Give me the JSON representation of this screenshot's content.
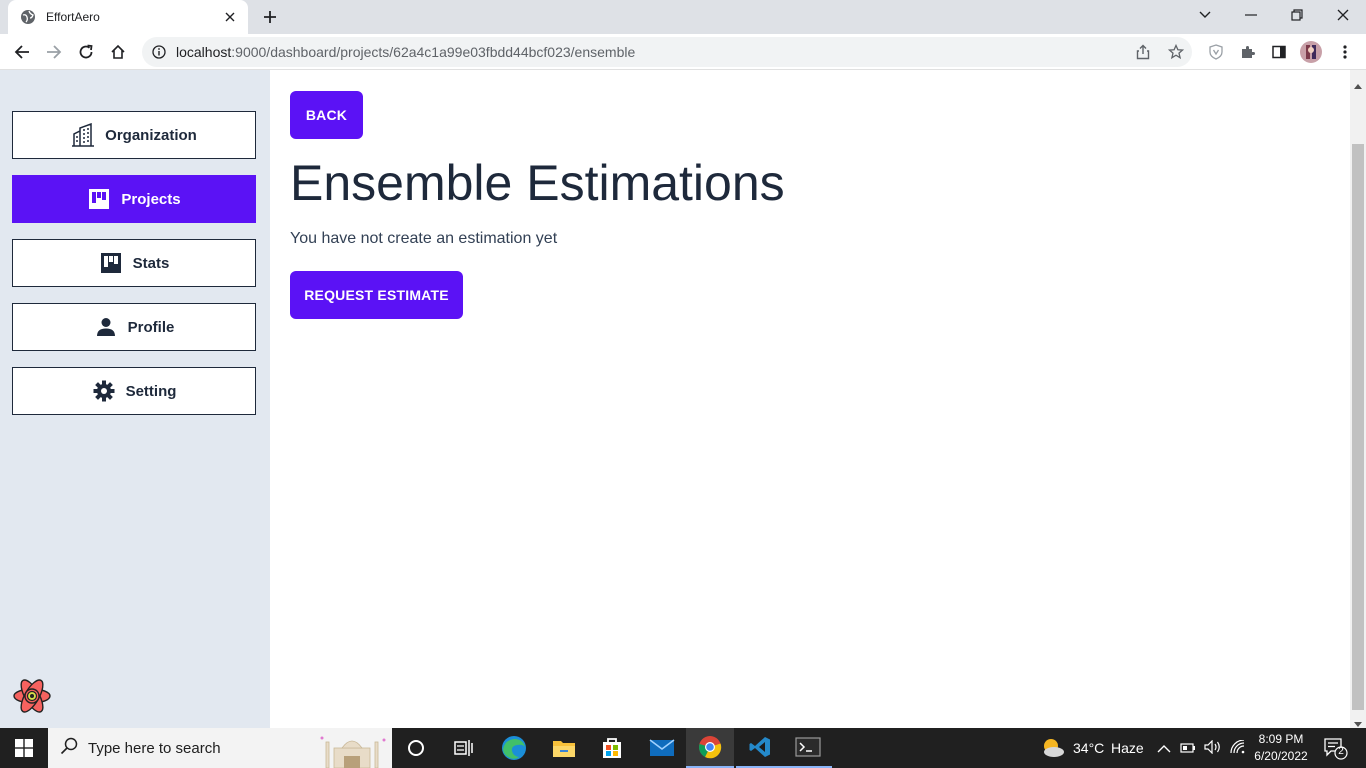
{
  "browser": {
    "tab_title": "EffortAero",
    "url_host": "localhost",
    "url_rest": ":9000/dashboard/projects/62a4c1a99e03fbdd44bcf023/ensemble"
  },
  "sidebar": {
    "items": [
      {
        "label": "Organization",
        "icon": "building-icon",
        "active": false
      },
      {
        "label": "Projects",
        "icon": "board-icon",
        "active": true
      },
      {
        "label": "Stats",
        "icon": "stats-icon",
        "active": false
      },
      {
        "label": "Profile",
        "icon": "person-icon",
        "active": false
      },
      {
        "label": "Setting",
        "icon": "gear-icon",
        "active": false
      }
    ]
  },
  "main": {
    "back_label": "BACK",
    "title": "Ensemble Estimations",
    "empty_text": "You have not create an estimation yet",
    "request_label": "REQUEST ESTIMATE"
  },
  "taskbar": {
    "search_placeholder": "Type here to search",
    "weather_temp": "34°C",
    "weather_desc": "Haze",
    "time": "8:09 PM",
    "date": "6/20/2022",
    "notification_count": "2"
  },
  "colors": {
    "accent": "#5b12f5",
    "sidebar_bg": "#e2e8f0",
    "text_dark": "#1e293b"
  }
}
